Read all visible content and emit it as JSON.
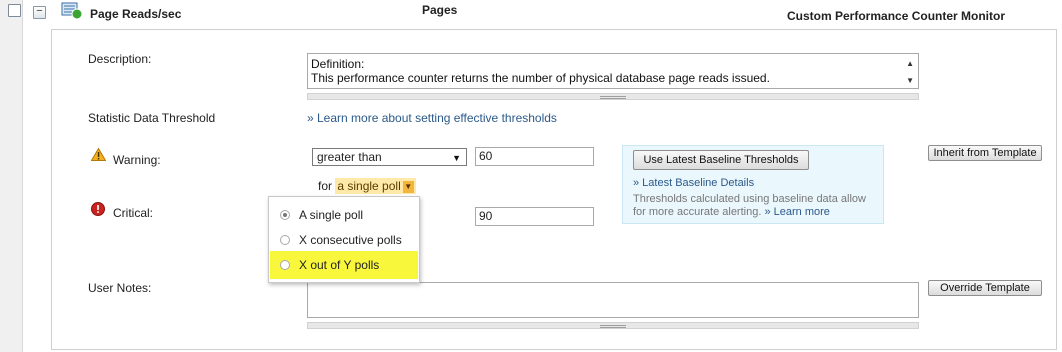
{
  "header": {
    "title": "Page Reads/sec",
    "column_pages": "Pages",
    "column_monitor_type": "Custom Performance Counter Monitor"
  },
  "description": {
    "label": "Description:",
    "line1": "Definition:",
    "line2": "This performance counter returns the number of physical database page reads issued."
  },
  "threshold": {
    "label": "Statistic Data Threshold",
    "learn_more": "» Learn more about setting effective thresholds"
  },
  "warning": {
    "label": "Warning:",
    "operator": "greater than",
    "value": "60",
    "for_prefix": "for",
    "poll_mode": "a single poll"
  },
  "critical": {
    "label": "Critical:",
    "value": "90"
  },
  "baseline": {
    "button": "Use Latest Baseline Thresholds",
    "details_link": "» Latest Baseline Details",
    "note": "Thresholds calculated using baseline data allow for more accurate alerting.",
    "learn_more": "» Learn more"
  },
  "buttons": {
    "inherit": "Inherit from Template",
    "override": "Override Template"
  },
  "poll_dropdown": {
    "options": [
      "A single poll",
      "X consecutive polls",
      "X out of Y polls"
    ],
    "selected": "A single poll",
    "highlighted": "X out of Y polls"
  },
  "user_notes": {
    "label": "User Notes:"
  },
  "colors": {
    "link": "#2b5a8a",
    "highlight": "#f9f73b",
    "baseline_bg": "#eaf7fc",
    "pill_bg": "#ffe9a8"
  }
}
